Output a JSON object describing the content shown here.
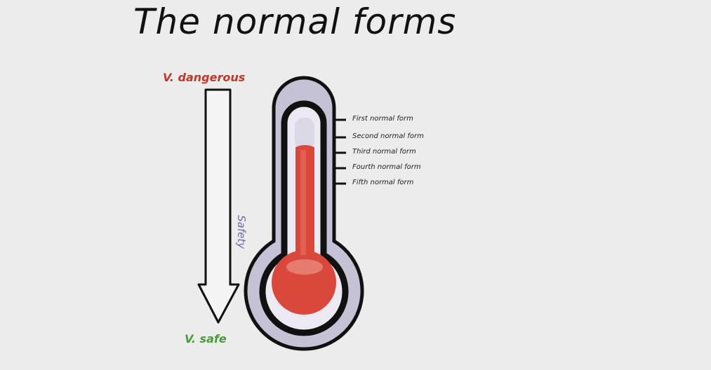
{
  "title": "The normal forms",
  "scale": {
    "top_label": "V. dangerous",
    "bottom_label": "V. safe",
    "axis_label": "Safety"
  },
  "thermometer": {
    "levels": [
      "First normal form",
      "Second normal form",
      "Third normal form",
      "Fourth normal form",
      "Fifth normal form"
    ]
  },
  "colors": {
    "danger": "#c0392b",
    "safe": "#4a9a3a",
    "axis": "#6a6aa8",
    "mercury": "#d9483b",
    "tube": "#c5c2d6",
    "outline": "#111111"
  }
}
